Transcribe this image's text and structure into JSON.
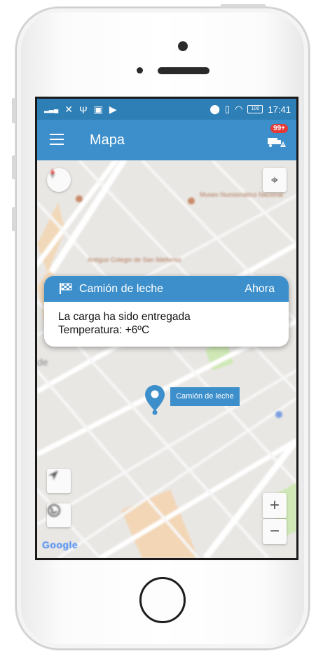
{
  "status_bar": {
    "time": "17:41",
    "battery": "100"
  },
  "app_bar": {
    "title": "Mapa",
    "alert_badge": "99+"
  },
  "notification": {
    "title": "Camión de leche",
    "time": "Ahora",
    "message": "La carga ha sido entregada",
    "temperature": "Temperatura: +6ºC"
  },
  "map": {
    "marker_label": "Camión de leche",
    "place_labels": [
      "Museo Numismático Nacional",
      "Antiguo Colegio de San Ildefonso"
    ],
    "zoom_in": "+",
    "zoom_out": "−",
    "attribution": "Google"
  },
  "colors": {
    "primary": "#3c8fcb",
    "status_bar": "#2f7fb7",
    "badge": "#e53935"
  }
}
